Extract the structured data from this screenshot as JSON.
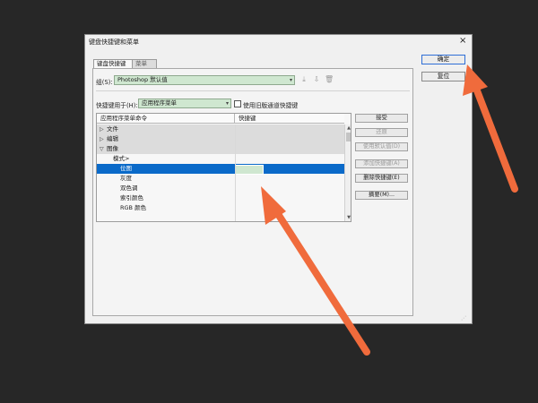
{
  "dialog": {
    "title": "键盘快捷键和菜单",
    "close": "×"
  },
  "tabs": [
    {
      "label": "键盘快捷键"
    },
    {
      "label": "菜单"
    }
  ],
  "group": {
    "label": "组(S):",
    "value": "Photoshop 默认值"
  },
  "shortcuts_for": {
    "label": "快捷键用于(H):",
    "value": "应用程序菜单"
  },
  "legacy_undo": {
    "label": "使用旧版通道快捷键",
    "checked": false
  },
  "table": {
    "headers": [
      "应用程序菜单命令",
      "快捷键"
    ],
    "rows": [
      {
        "label": "文件",
        "type": "group",
        "expanded": false
      },
      {
        "label": "编辑",
        "type": "group",
        "expanded": false
      },
      {
        "label": "图像",
        "type": "group",
        "expanded": true
      },
      {
        "label": "模式>",
        "type": "item"
      },
      {
        "label": "位图",
        "type": "item",
        "selected": true
      },
      {
        "label": "灰度",
        "type": "item"
      },
      {
        "label": "双色调",
        "type": "item"
      },
      {
        "label": "索引颜色",
        "type": "item"
      },
      {
        "label": "RGB 颜色",
        "type": "item"
      }
    ]
  },
  "side_buttons": {
    "accept": "接受",
    "undo": "还原",
    "use_default": "使用默认值(D)",
    "add_shortcut": "添加快捷键(A)",
    "delete_shortcut": "删除快捷键(E)",
    "summarize": "摘要(M)..."
  },
  "main_buttons": {
    "ok": "确定",
    "reset": "复位"
  },
  "colors": {
    "selection": "#0a6ac9",
    "field_green": "#cfe7d0",
    "arrow": "#f06b3c"
  }
}
